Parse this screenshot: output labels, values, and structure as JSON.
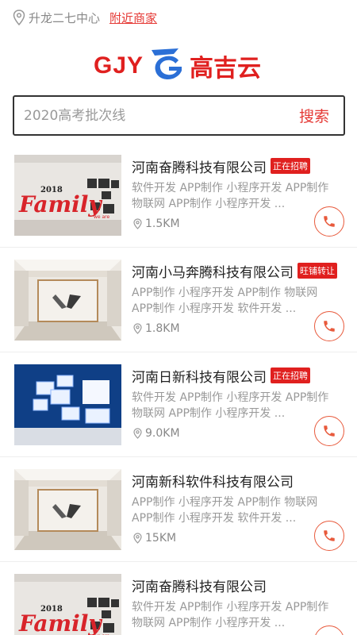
{
  "header": {
    "location": "升龙二七中心",
    "nearby_link": "附近商家",
    "location_icon": "location-pin-icon"
  },
  "logo": {
    "text_en": "GJY",
    "text_cn": "高吉云",
    "brand_color": "#e0201f",
    "accent_color": "#2b6fd6"
  },
  "search": {
    "placeholder": "2020高考批次线",
    "button_label": "搜索"
  },
  "colors": {
    "accent": "#e53935",
    "badge": "#e0201f",
    "phone_icon": "#e85a3c"
  },
  "companies": [
    {
      "name": "河南奋腾科技有限公司",
      "badge": "正在招聘",
      "desc": "软件开发 APP制作 小程序开发 APP制作 物联网 APP制作 小程序开发 ...",
      "distance": "1.5KM",
      "thumb": "family-wall",
      "thumb_text": "Family",
      "thumb_year": "2018",
      "thumb_sub": "we are"
    },
    {
      "name": "河南小马奔腾科技有限公司",
      "badge": "旺铺转让",
      "desc": "APP制作 小程序开发 APP制作 物联网 APP制作 小程序开发 软件开发 ...",
      "distance": "1.8KM",
      "thumb": "office-logo"
    },
    {
      "name": "河南日新科技有限公司",
      "badge": "正在招聘",
      "desc": "软件开发 APP制作 小程序开发 APP制作 物联网 APP制作 小程序开发 ...",
      "distance": "9.0KM",
      "thumb": "blue-wall"
    },
    {
      "name": "河南新科软件科技有限公司",
      "badge": "",
      "desc": "APP制作 小程序开发 APP制作 物联网 APP制作 小程序开发 软件开发 ...",
      "distance": "15KM",
      "thumb": "office-logo"
    },
    {
      "name": "河南奋腾科技有限公司",
      "badge": "",
      "desc": "软件开发 APP制作 小程序开发 APP制作 物联网 APP制作 小程序开发 ...",
      "distance": "",
      "thumb": "family-wall",
      "thumb_text": "Family",
      "thumb_year": "2018",
      "thumb_sub": "we are"
    }
  ]
}
